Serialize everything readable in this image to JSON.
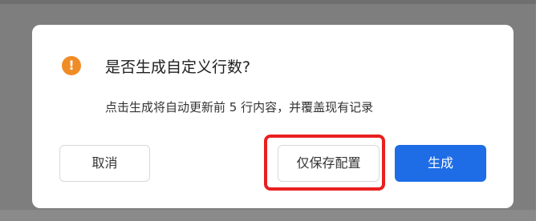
{
  "dialog": {
    "title": "是否生成自定义行数?",
    "description": "点击生成将自动更新前 5 行内容，并覆盖现有记录",
    "icon": "warning-icon",
    "icon_glyph": "!",
    "accent_color": "#f08c26"
  },
  "buttons": {
    "cancel_label": "取消",
    "save_config_label": "仅保存配置",
    "generate_label": "生成",
    "primary_color": "#1e6ce6"
  },
  "highlight_color": "#e8201f"
}
